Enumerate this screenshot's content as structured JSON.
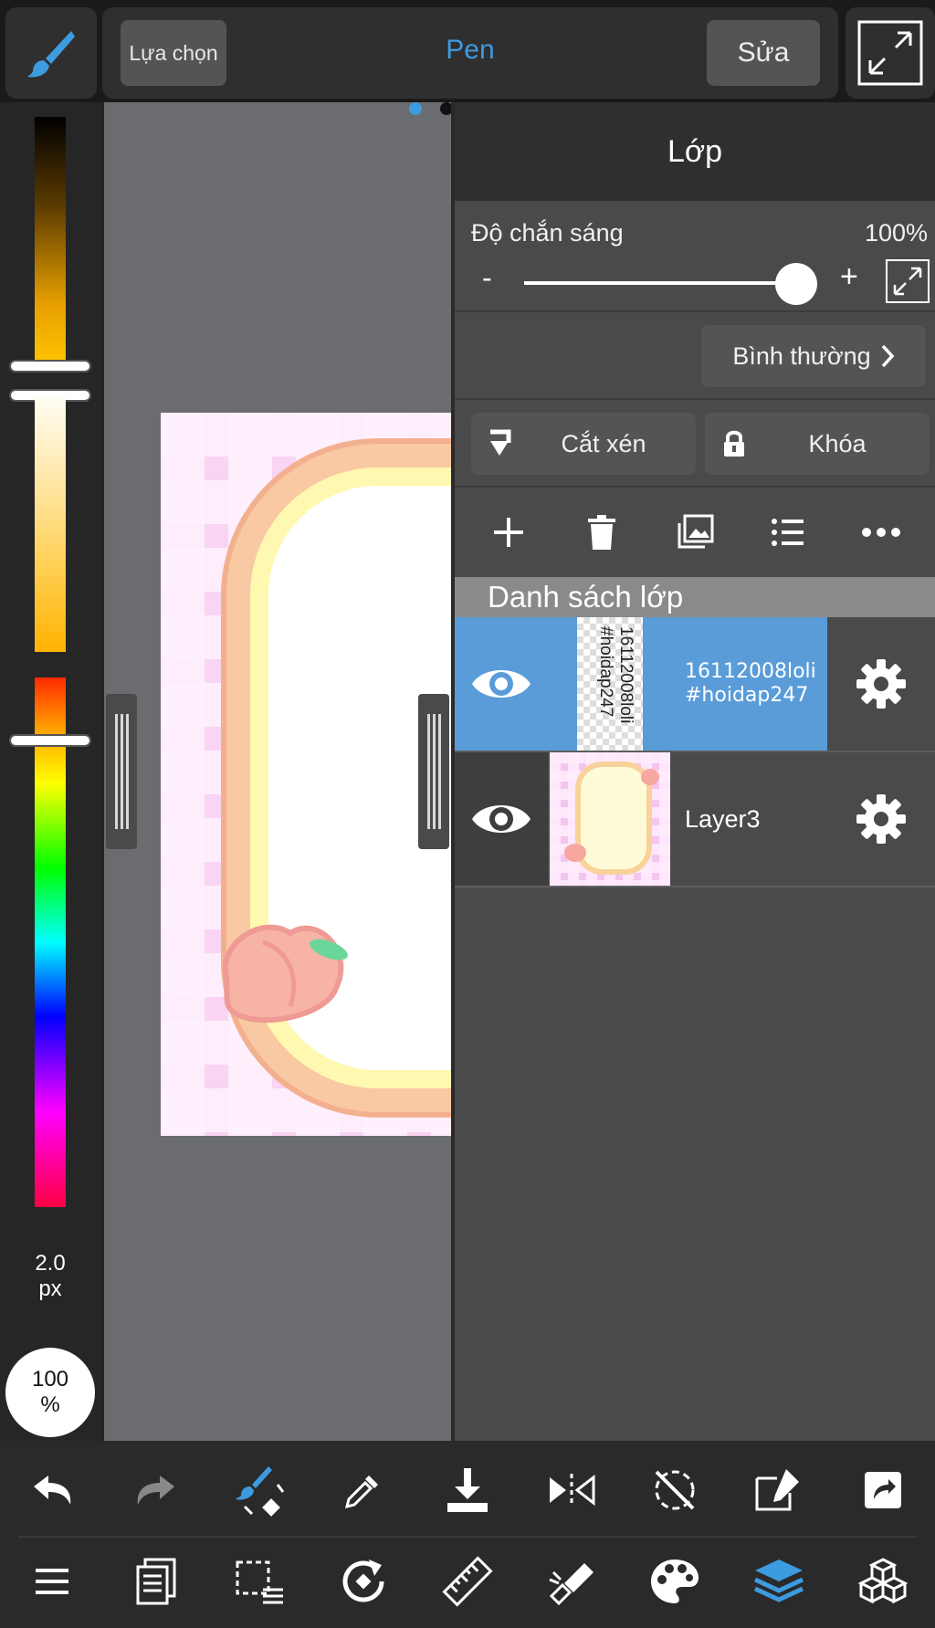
{
  "topbar": {
    "select_label": "Lựa chọn",
    "tool_name": "Pen",
    "edit_label": "Sửa"
  },
  "colors": {
    "accent": "#3d9be0",
    "selected_layer": "#5a9cd8",
    "panel_bg": "#4a4a4a",
    "canvas_bg": "#6a6c70"
  },
  "left_bar": {
    "brush_size_value": "2.0",
    "brush_size_unit": "px",
    "opacity_value": "100",
    "opacity_unit": "%"
  },
  "layer_panel": {
    "title": "Lớp",
    "opacity_label": "Độ chắn sáng",
    "opacity_value": "100%",
    "opacity_level": 1.0,
    "minus_label": "-",
    "plus_label": "+",
    "blend_mode": "Bình thường",
    "clip_label": "Cắt xén",
    "lock_label": "Khóa",
    "list_header": "Danh sách lớp",
    "layers": [
      {
        "name_line1": "16112008loli",
        "name_line2": "#hoidap247",
        "thumb_line1": "16112008loli",
        "thumb_line2": "#hoidap247",
        "visible": true,
        "selected": true
      },
      {
        "name": "Layer3",
        "visible": true,
        "selected": false
      }
    ]
  },
  "icons": {
    "top": [
      "brush-icon",
      "fullscreen-icon"
    ],
    "actions": [
      "add-layer-icon",
      "delete-layer-icon",
      "import-image-icon",
      "layer-list-icon",
      "more-icon"
    ],
    "toolbar_row1": [
      "undo-icon",
      "redo-icon",
      "brush-transform-icon",
      "eyedropper-icon",
      "download-icon",
      "flip-icon",
      "no-rotate-icon",
      "edit-canvas-icon",
      "share-icon"
    ],
    "toolbar_row2": [
      "menu-icon",
      "pages-icon",
      "selection-icon",
      "rotate-icon",
      "ruler-icon",
      "fill-icon",
      "palette-icon",
      "layers-icon",
      "materials-icon"
    ]
  }
}
